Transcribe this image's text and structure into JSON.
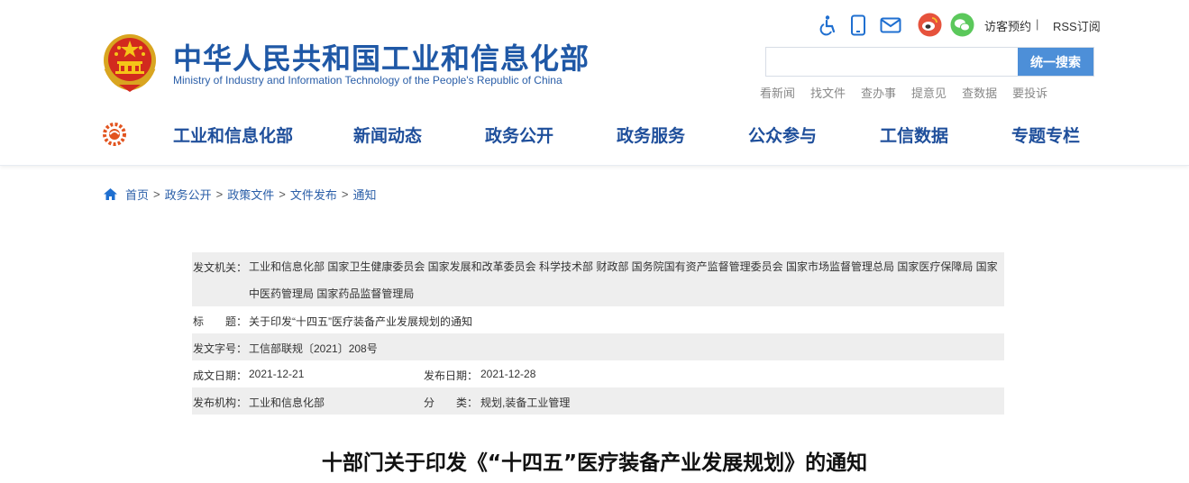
{
  "header": {
    "title": "中华人民共和国工业和信息化部",
    "subtitle": "Ministry of Industry and Information Technology of the People's Republic of China",
    "icons": [
      "accessibility-icon",
      "mobile-icon",
      "mail-icon",
      "weibo-icon",
      "wechat-icon"
    ],
    "visit_label": "访客预约",
    "separator": "|",
    "rss_label": "RSS订阅",
    "search": {
      "placeholder": "",
      "button_label": "统一搜索"
    },
    "quick_links": [
      "看新闻",
      "找文件",
      "查办事",
      "提意见",
      "查数据",
      "要投诉"
    ],
    "nav_items": [
      "工业和信息化部",
      "新闻动态",
      "政务公开",
      "政务服务",
      "公众参与",
      "工信数据",
      "专题专栏"
    ]
  },
  "breadcrumb": {
    "items": [
      "首页",
      "政务公开",
      "政策文件",
      "文件发布",
      "通知"
    ],
    "separator": ">"
  },
  "info": {
    "issuer_label": "发文机关：",
    "issuer_value": "工业和信息化部 国家卫生健康委员会 国家发展和改革委员会 科学技术部 财政部 国务院国有资产监督管理委员会 国家市场监督管理总局 国家医疗保障局 国家中医药管理局 国家药品监督管理局",
    "title_label": "标　　题：",
    "title_value": "关于印发“十四五”医疗装备产业发展规划的通知",
    "docno_label": "发文字号：",
    "docno_value": "工信部联规〔2021〕208号",
    "written_label": "成文日期：",
    "written_value": "2021-12-21",
    "published_label": "发布日期：",
    "published_value": "2021-12-28",
    "agency_label": "发布机构：",
    "agency_value": "工业和信息化部",
    "category_label": "分　　类：",
    "category_value": "规划,装备工业管理"
  },
  "document": {
    "title": "十部门关于印发《“十四五”医疗装备产业发展规划》的通知"
  },
  "colors": {
    "brand_blue": "#1f58a6",
    "nav_blue": "#1f4f9b",
    "search_button": "#4d8fd8",
    "weibo_red": "#e6523c",
    "wechat_green": "#5bc85b",
    "table_gray": "#eeeeee"
  }
}
